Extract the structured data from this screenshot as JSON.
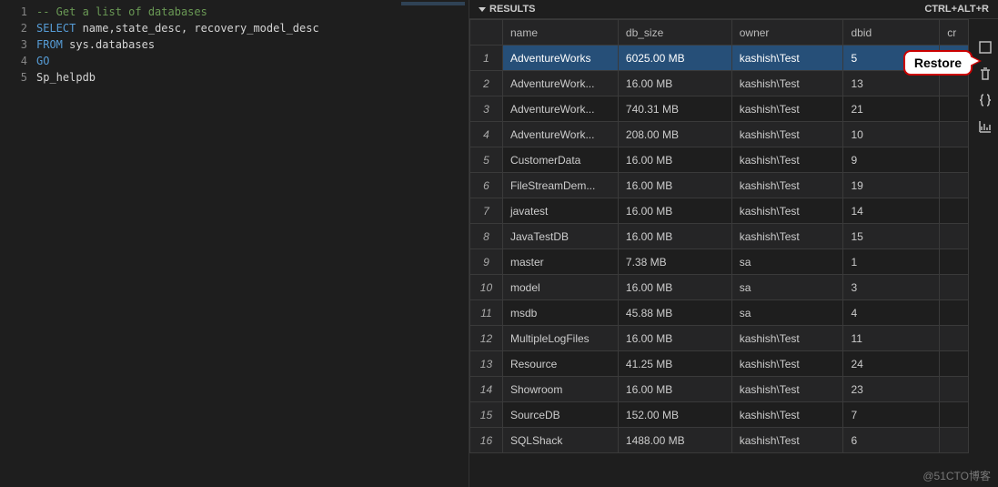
{
  "editor": {
    "lines": [
      {
        "n": "1",
        "tokens": [
          {
            "cls": "tok-comment",
            "t": "-- Get a list of databases"
          }
        ]
      },
      {
        "n": "2",
        "tokens": [
          {
            "cls": "tok-keyword",
            "t": "SELECT "
          },
          {
            "cls": "tok-ident",
            "t": "name"
          },
          {
            "cls": "tok-punct",
            "t": ","
          },
          {
            "cls": "tok-ident",
            "t": "state_desc"
          },
          {
            "cls": "tok-punct",
            "t": ", "
          },
          {
            "cls": "tok-ident",
            "t": "recovery_model_desc"
          }
        ]
      },
      {
        "n": "3",
        "tokens": [
          {
            "cls": "tok-keyword",
            "t": "FROM "
          },
          {
            "cls": "tok-ident",
            "t": "sys.databases"
          }
        ]
      },
      {
        "n": "4",
        "tokens": [
          {
            "cls": "tok-keyword",
            "t": "GO"
          }
        ]
      },
      {
        "n": "5",
        "tokens": [
          {
            "cls": "tok-ident",
            "t": "Sp_helpdb"
          }
        ]
      }
    ]
  },
  "results": {
    "title": "RESULTS",
    "shortcut": "CTRL+ALT+R",
    "columns": [
      "name",
      "db_size",
      "owner",
      "dbid"
    ],
    "last_col_hint": "cr",
    "rows": [
      {
        "name": "AdventureWorks",
        "db_size": "6025.00 MB",
        "owner": "kashish\\Test",
        "dbid": "5",
        "selected": true
      },
      {
        "name": "AdventureWork...",
        "db_size": "16.00 MB",
        "owner": "kashish\\Test",
        "dbid": "13"
      },
      {
        "name": "AdventureWork...",
        "db_size": "740.31 MB",
        "owner": "kashish\\Test",
        "dbid": "21"
      },
      {
        "name": "AdventureWork...",
        "db_size": "208.00 MB",
        "owner": "kashish\\Test",
        "dbid": "10"
      },
      {
        "name": "CustomerData",
        "db_size": "16.00 MB",
        "owner": "kashish\\Test",
        "dbid": "9"
      },
      {
        "name": "FileStreamDem...",
        "db_size": "16.00 MB",
        "owner": "kashish\\Test",
        "dbid": "19"
      },
      {
        "name": "javatest",
        "db_size": "16.00 MB",
        "owner": "kashish\\Test",
        "dbid": "14"
      },
      {
        "name": "JavaTestDB",
        "db_size": "16.00 MB",
        "owner": "kashish\\Test",
        "dbid": "15"
      },
      {
        "name": "master",
        "db_size": "7.38 MB",
        "owner": "sa",
        "dbid": "1"
      },
      {
        "name": "model",
        "db_size": "16.00 MB",
        "owner": "sa",
        "dbid": "3"
      },
      {
        "name": "msdb",
        "db_size": "45.88 MB",
        "owner": "sa",
        "dbid": "4"
      },
      {
        "name": "MultipleLogFiles",
        "db_size": "16.00 MB",
        "owner": "kashish\\Test",
        "dbid": "11"
      },
      {
        "name": "Resource",
        "db_size": "41.25 MB",
        "owner": "kashish\\Test",
        "dbid": "24"
      },
      {
        "name": "Showroom",
        "db_size": "16.00 MB",
        "owner": "kashish\\Test",
        "dbid": "23"
      },
      {
        "name": "SourceDB",
        "db_size": "152.00 MB",
        "owner": "kashish\\Test",
        "dbid": "7"
      },
      {
        "name": "SQLShack",
        "db_size": "1488.00 MB",
        "owner": "kashish\\Test",
        "dbid": "6"
      }
    ]
  },
  "callout": {
    "label": "Restore"
  },
  "side_icons": [
    "maximize-icon",
    "trash-icon",
    "json-icon",
    "chart-icon"
  ],
  "watermark": "@51CTO博客"
}
